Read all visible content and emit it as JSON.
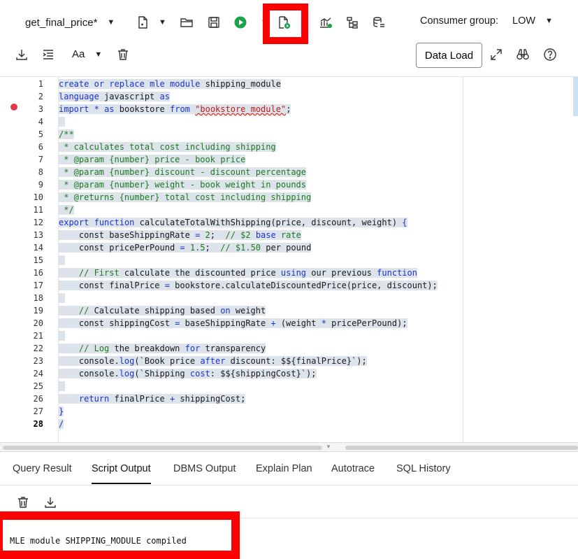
{
  "toolbar": {
    "tab_title": "get_final_price*",
    "consumer_label": "Consumer group:",
    "consumer_value": "LOW",
    "data_load_label": "Data Load",
    "font_label": "Aa"
  },
  "editor": {
    "lines": [
      {
        "n": "1",
        "tokens": [
          [
            "kw",
            "create"
          ],
          [
            "tx",
            " "
          ],
          [
            "kw",
            "or"
          ],
          [
            "tx",
            " "
          ],
          [
            "kw",
            "replace"
          ],
          [
            "tx",
            " "
          ],
          [
            "kw",
            "mle"
          ],
          [
            "tx",
            " "
          ],
          [
            "kw",
            "module"
          ],
          [
            "tx",
            " shipping_module"
          ]
        ]
      },
      {
        "n": "2",
        "tokens": [
          [
            "kw",
            "language"
          ],
          [
            "tx",
            " javascript "
          ],
          [
            "kw",
            "as"
          ]
        ]
      },
      {
        "n": "3",
        "tokens": [
          [
            "kw",
            "import"
          ],
          [
            "tx",
            " "
          ],
          [
            "op",
            "*"
          ],
          [
            "tx",
            " "
          ],
          [
            "kw",
            "as"
          ],
          [
            "tx",
            " bookstore "
          ],
          [
            "kw",
            "from"
          ],
          [
            "tx",
            " "
          ],
          [
            "str",
            "\"bookstore_module\""
          ],
          [
            "tx",
            ";"
          ]
        ]
      },
      {
        "n": "4",
        "tokens": []
      },
      {
        "n": "5",
        "tokens": [
          [
            "cm",
            "/**"
          ]
        ]
      },
      {
        "n": "6",
        "tokens": [
          [
            "cm",
            " * calculates total cost including shipping"
          ]
        ]
      },
      {
        "n": "7",
        "tokens": [
          [
            "cm",
            " * @param {number} price - book price"
          ]
        ]
      },
      {
        "n": "8",
        "tokens": [
          [
            "cm",
            " * @param {number} discount - discount percentage"
          ]
        ]
      },
      {
        "n": "9",
        "tokens": [
          [
            "cm",
            " * @param {number} weight - book weight in pounds"
          ]
        ]
      },
      {
        "n": "10",
        "tokens": [
          [
            "cm",
            " * @returns {number} total cost including shipping"
          ]
        ]
      },
      {
        "n": "11",
        "tokens": [
          [
            "cm",
            " */"
          ]
        ]
      },
      {
        "n": "12",
        "tokens": [
          [
            "kw",
            "export"
          ],
          [
            "tx",
            " "
          ],
          [
            "kw",
            "function"
          ],
          [
            "tx",
            " calculateTotalWithShipping(price, discount, weight) "
          ],
          [
            "kw",
            "{"
          ]
        ]
      },
      {
        "n": "13",
        "tokens": [
          [
            "tx",
            "    const baseShippingRate "
          ],
          [
            "op",
            "="
          ],
          [
            "tx",
            " "
          ],
          [
            "num",
            "2"
          ],
          [
            "tx",
            ";  "
          ],
          [
            "cm",
            "// $2 "
          ],
          [
            "kw",
            "base"
          ],
          [
            "cm",
            " rate"
          ]
        ]
      },
      {
        "n": "14",
        "tokens": [
          [
            "tx",
            "    const pricePerPound "
          ],
          [
            "op",
            "="
          ],
          [
            "tx",
            " "
          ],
          [
            "num",
            "1.5"
          ],
          [
            "tx",
            ";  "
          ],
          [
            "cm",
            "// $1.50 "
          ],
          [
            "tx",
            "per pound"
          ]
        ]
      },
      {
        "n": "15",
        "tokens": []
      },
      {
        "n": "16",
        "tokens": [
          [
            "tx",
            "    "
          ],
          [
            "cm",
            "// First"
          ],
          [
            "tx",
            " calculate the discounted price "
          ],
          [
            "kw",
            "using"
          ],
          [
            "tx",
            " our previous "
          ],
          [
            "kw",
            "function"
          ]
        ]
      },
      {
        "n": "17",
        "tokens": [
          [
            "tx",
            "    const finalPrice "
          ],
          [
            "op",
            "="
          ],
          [
            "tx",
            " bookstore.calculateDiscountedPrice(price, discount);"
          ]
        ]
      },
      {
        "n": "18",
        "tokens": []
      },
      {
        "n": "19",
        "tokens": [
          [
            "tx",
            "    "
          ],
          [
            "cm",
            "//"
          ],
          [
            "tx",
            " Calculate shipping based "
          ],
          [
            "kw",
            "on"
          ],
          [
            "tx",
            " weight"
          ]
        ]
      },
      {
        "n": "20",
        "tokens": [
          [
            "tx",
            "    const shippingCost "
          ],
          [
            "op",
            "="
          ],
          [
            "tx",
            " baseShippingRate "
          ],
          [
            "op",
            "+"
          ],
          [
            "tx",
            " (weight "
          ],
          [
            "op",
            "*"
          ],
          [
            "tx",
            " pricePerPound);"
          ]
        ]
      },
      {
        "n": "21",
        "tokens": []
      },
      {
        "n": "22",
        "tokens": [
          [
            "tx",
            "    "
          ],
          [
            "cm",
            "// Log"
          ],
          [
            "tx",
            " the breakdown "
          ],
          [
            "kw",
            "for"
          ],
          [
            "tx",
            " transparency"
          ]
        ]
      },
      {
        "n": "23",
        "tokens": [
          [
            "tx",
            "    console."
          ],
          [
            "kw",
            "log"
          ],
          [
            "tx",
            "(`Book price "
          ],
          [
            "kw",
            "after"
          ],
          [
            "tx",
            " discount: $${finalPrice}`);"
          ]
        ]
      },
      {
        "n": "24",
        "tokens": [
          [
            "tx",
            "    console."
          ],
          [
            "kw",
            "log"
          ],
          [
            "tx",
            "(`Shipping "
          ],
          [
            "kw",
            "cost"
          ],
          [
            "tx",
            ": $${shippingCost}`);"
          ]
        ]
      },
      {
        "n": "25",
        "tokens": []
      },
      {
        "n": "26",
        "tokens": [
          [
            "tx",
            "    "
          ],
          [
            "kw",
            "return"
          ],
          [
            "tx",
            " finalPrice "
          ],
          [
            "op",
            "+"
          ],
          [
            "tx",
            " shippingCost;"
          ]
        ]
      },
      {
        "n": "27",
        "tokens": [
          [
            "kw",
            "}"
          ]
        ]
      },
      {
        "n": "28",
        "tokens": [
          [
            "kw",
            "/"
          ]
        ]
      }
    ]
  },
  "output_tabs": [
    "Query Result",
    "Script Output",
    "DBMS Output",
    "Explain Plan",
    "Autotrace",
    "SQL History"
  ],
  "output": {
    "text": "MLE module SHIPPING_MODULE compiled"
  }
}
